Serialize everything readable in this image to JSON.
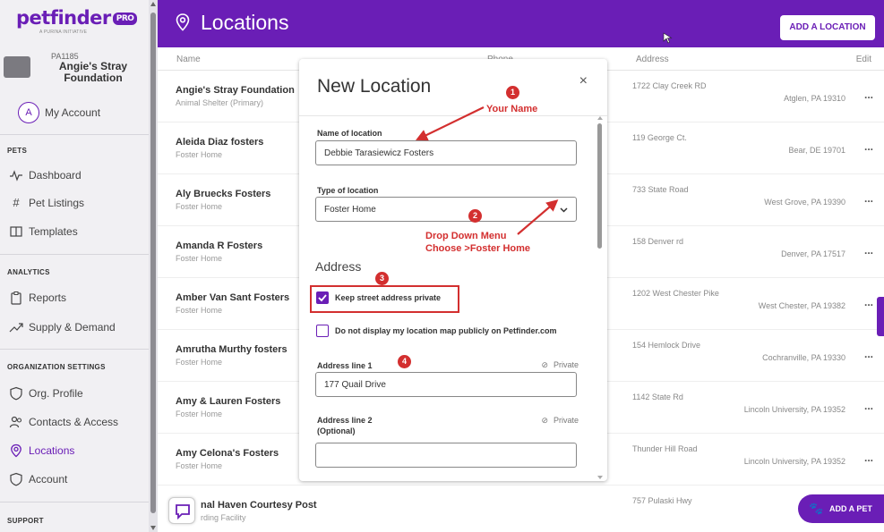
{
  "sidebar": {
    "brand": "petfinder",
    "brand_badge": "PRO",
    "brand_sub": "A PURINA INITIATIVE",
    "org_id": "PA1185",
    "org_name": "Angie's Stray Foundation",
    "account_initial": "A",
    "account_label": "My Account",
    "sections": {
      "pets": "PETS",
      "analytics": "ANALYTICS",
      "org_settings": "ORGANIZATION SETTINGS",
      "support": "SUPPORT"
    },
    "items": {
      "dashboard": "Dashboard",
      "pet_listings": "Pet Listings",
      "templates": "Templates",
      "reports": "Reports",
      "supply_demand": "Supply & Demand",
      "org_profile": "Org. Profile",
      "contacts_access": "Contacts & Access",
      "locations": "Locations",
      "account": "Account"
    }
  },
  "header": {
    "title": "Locations",
    "add_location": "ADD A LOCATION"
  },
  "table": {
    "columns": {
      "name": "Name",
      "phone": "Phone",
      "address": "Address",
      "edit": "Edit"
    },
    "rows": [
      {
        "name": "Angie's Stray Foundation",
        "type": "Animal Shelter (Primary)",
        "address": "1722 Clay Creek RD",
        "city": "Atglen, PA 19310",
        "edit": "..."
      },
      {
        "name": "Aleida Diaz fosters",
        "type": "Foster Home",
        "address": "119 George Ct.",
        "city": "Bear, DE 19701",
        "edit": "..."
      },
      {
        "name": "Aly Bruecks Fosters",
        "type": "Foster Home",
        "address": "733 State Road",
        "city": "West Grove, PA 19390",
        "edit": "..."
      },
      {
        "name": "Amanda R Fosters",
        "type": "Foster Home",
        "address": "158 Denver rd",
        "city": "Denver, PA 17517",
        "edit": "..."
      },
      {
        "name": "Amber Van Sant Fosters",
        "type": "Foster Home",
        "address": "1202 West Chester Pike",
        "city": "West Chester, PA 19382",
        "edit": "..."
      },
      {
        "name": "Amrutha Murthy fosters",
        "type": "Foster Home",
        "address": "154 Hemlock Drive",
        "city": "Cochranville, PA 19330",
        "edit": "..."
      },
      {
        "name": "Amy & Lauren Fosters",
        "type": "Foster Home",
        "address": "1142 State Rd",
        "city": "Lincoln University, PA 19352",
        "edit": "..."
      },
      {
        "name": "Amy Celona's Fosters",
        "type": "Foster Home",
        "address": "Thunder Hill Road",
        "city": "Lincoln University, PA 19352",
        "edit": "..."
      },
      {
        "name": "nal Haven Courtesy Post",
        "type": "rding Facility",
        "address": "757 Pulaski Hwy",
        "city": "Be",
        "edit": ""
      }
    ]
  },
  "modal": {
    "title": "New Location",
    "close": "×",
    "name_label": "Name of location",
    "name_value": "Debbie Tarasiewicz Fosters",
    "type_label": "Type of location",
    "type_value": "Foster Home",
    "address_heading": "Address",
    "keep_private": "Keep street address private",
    "no_map": "Do not display my location map publicly on Petfinder.com",
    "addr1_label": "Address line 1",
    "addr1_value": "177 Quail Drive",
    "addr2_label": "Address line 2",
    "addr2_optional": "(Optional)",
    "addr2_value": "",
    "private": "Private"
  },
  "annotations": {
    "badge1": "1",
    "badge2": "2",
    "badge3": "3",
    "badge4": "4",
    "your_name": "Your Name",
    "dropdown_line1": "Drop Down Menu",
    "dropdown_line2": "Choose >Foster Home"
  },
  "floating": {
    "add_pet": "ADD A PET"
  },
  "colors": {
    "brand_purple": "#6a1eb6",
    "annotation_red": "#d32f2f"
  }
}
